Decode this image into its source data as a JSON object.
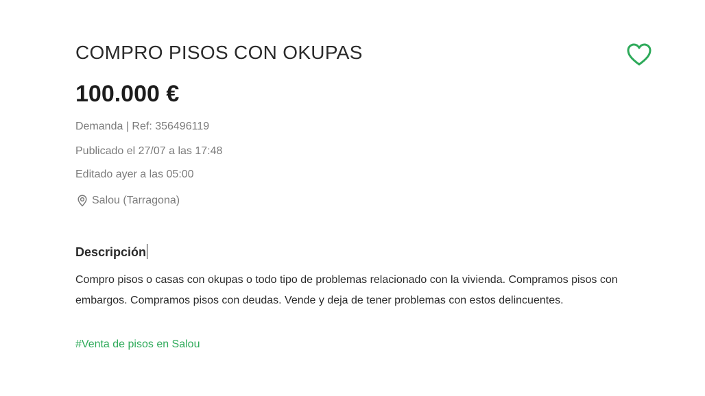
{
  "listing": {
    "title": "COMPRO PISOS CON OKUPAS",
    "price": "100.000 €",
    "ref_line": "Demanda | Ref: 356496119",
    "published": "Publicado el 27/07 a las 17:48",
    "edited": "Editado ayer a las 05:00",
    "location": "Salou (Tarragona)",
    "favorite_icon": "heart-outline-icon",
    "location_icon": "map-pin-icon"
  },
  "description": {
    "heading": "Descripción",
    "body": "Compro pisos o casas con okupas o todo tipo de problemas relacionado con la vivienda. Compramos pisos con embargos. Compramos pisos con deudas. Vende y deja de tener problemas con estos delincuentes.",
    "hashtag": "#Venta de pisos en Salou"
  },
  "colors": {
    "accent_green": "#2eaa5a",
    "meta_gray": "#7b7b7b",
    "text_dark": "#1c1c1c"
  }
}
